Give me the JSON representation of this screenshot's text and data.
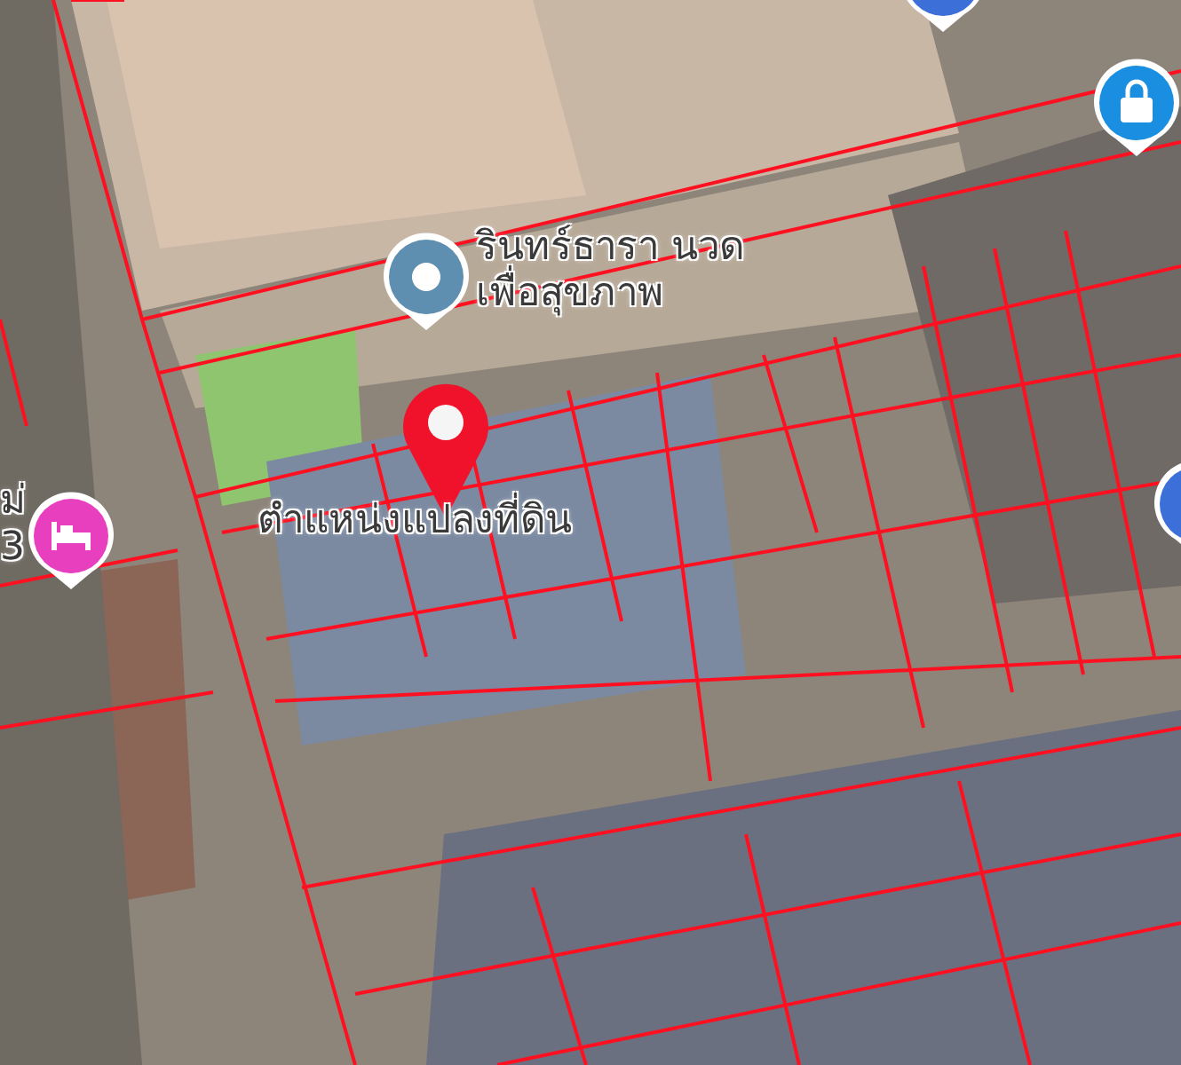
{
  "map": {
    "markers": [
      {
        "kind": "place",
        "color": "#5f8fb0",
        "label_lines": [
          "รินทร์ธารา นวด",
          "เพื่อสุขภาพ"
        ]
      },
      {
        "kind": "hotel",
        "color": "#e83fbf",
        "label_lines": [
          "ม่",
          "3"
        ]
      },
      {
        "kind": "shop",
        "color": "#1a8ee0"
      },
      {
        "kind": "blue-top",
        "color": "#3d6fd8"
      },
      {
        "kind": "blue-edge",
        "color": "#3d6fd8"
      },
      {
        "kind": "location",
        "color": "#f0122a",
        "label_lines": [
          "ตำแหน่งแปลงที่ดิน"
        ]
      }
    ]
  }
}
